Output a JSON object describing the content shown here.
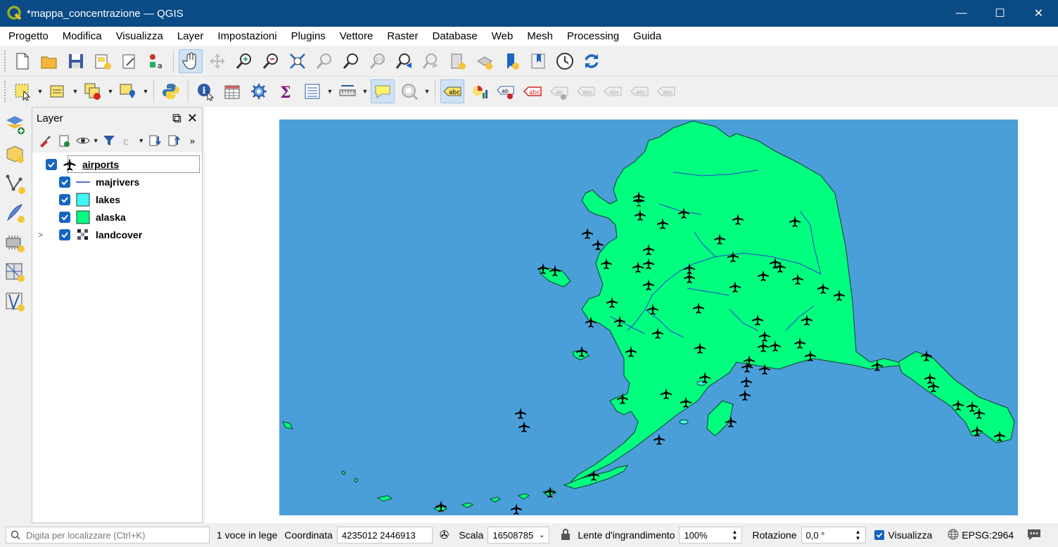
{
  "window": {
    "title": "*mappa_concentrazione — QGIS",
    "minimize": "—",
    "maximize": "☐",
    "close": "✕"
  },
  "menu": [
    "Progetto",
    "Modifica",
    "Visualizza",
    "Layer",
    "Impostazioni",
    "Plugins",
    "Vettore",
    "Raster",
    "Database",
    "Web",
    "Mesh",
    "Processing",
    "Guida"
  ],
  "layer_panel": {
    "title": "Layer",
    "layers": [
      {
        "name": "airports",
        "visible": true,
        "selected": true,
        "symbol": "airplane-icon"
      },
      {
        "name": "majrivers",
        "visible": true,
        "symbol": "line-symbol",
        "color": "#5b6fd6"
      },
      {
        "name": "lakes",
        "visible": true,
        "symbol": "fill-symbol",
        "color": "#40f5f5"
      },
      {
        "name": "alaska",
        "visible": true,
        "symbol": "fill-symbol",
        "color": "#00ff80"
      },
      {
        "name": "landcover",
        "visible": true,
        "symbol": "raster-symbol",
        "expandable": true,
        "expand_glyph": ">"
      }
    ]
  },
  "map": {
    "sea_color": "#4a9fd8",
    "land_color": "#00ff7f",
    "river_color": "#2a3fd0"
  },
  "statusbar": {
    "search_placeholder": "Digita per localizzare (Ctrl+K)",
    "legend_info": "1 voce in lege",
    "coord_label": "Coordinata",
    "coord_value": "4235012  2446913",
    "scale_label": "Scala",
    "scale_value": "16508785",
    "magnifier_label": "Lente d'ingrandimento",
    "magnifier_value": "100%",
    "rotation_label": "Rotazione",
    "rotation_value": "0,0 °",
    "render_label": "Visualizza",
    "crs": "EPSG:2964"
  }
}
